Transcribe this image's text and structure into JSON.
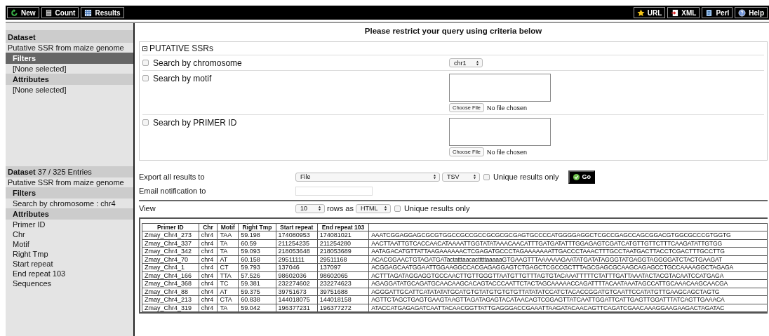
{
  "toolbar": {
    "left_buttons": [
      {
        "label": "New",
        "kind": "refresh"
      },
      {
        "label": "Count",
        "kind": "calculator"
      },
      {
        "label": "Results",
        "kind": "table"
      }
    ],
    "right_buttons": [
      {
        "label": "URL",
        "kind": "star"
      },
      {
        "label": "XML",
        "kind": "xml"
      },
      {
        "label": "Perl",
        "kind": "script"
      },
      {
        "label": "Help",
        "kind": "help"
      }
    ]
  },
  "sidebar": {
    "blocks": [
      {
        "heading": "Dataset",
        "name": "Putative SSR from maize genome",
        "filters_label": "Filters",
        "filters_active": true,
        "filters": [
          "[None selected]"
        ],
        "attributes_label": "Attributes",
        "attributes": [
          "[None selected]"
        ]
      },
      {
        "heading": "**Dataset** 37 / 325 Entries",
        "name": "Putative SSR from maize genome",
        "filters_label": "Filters",
        "filters_active": false,
        "filters": [
          "Search by chromosome : chr4"
        ],
        "attributes_label": "Attributes",
        "attributes": [
          "Primer ID",
          "Chr",
          "Motif",
          "Right Tmp",
          "Start repeat",
          "End repeat 103",
          "Sequences"
        ]
      }
    ]
  },
  "main": {
    "title": "Please restrict your query using criteria below",
    "filter_panel": {
      "title": "PUTATIVE SSRs",
      "expanded": true,
      "filters": [
        {
          "label": "Search by chromosome",
          "checked": false,
          "kind": "select",
          "value": "chr1"
        },
        {
          "label": "Search by motif",
          "checked": false,
          "kind": "upload",
          "button": "Choose File",
          "file_status": "No file chosen"
        },
        {
          "label": "Search by PRIMER ID",
          "checked": false,
          "kind": "upload",
          "button": "Choose File",
          "file_status": "No file chosen"
        }
      ]
    },
    "export": {
      "label": "Export  all results to",
      "destination": "File",
      "format": "TSV",
      "unique_label": "Unique results only",
      "unique_checked": false,
      "go": "Go"
    },
    "email": {
      "label": "Email notification to"
    },
    "view": {
      "label": "View",
      "rows": "10",
      "rows_as": "rows as",
      "format": "HTML",
      "unique_label": "Unique results only",
      "unique_checked": false
    },
    "table": {
      "columns": [
        "Primer ID",
        "Chr",
        "Motif",
        "Right Tmp",
        "Start repeat",
        "End repeat 103"
      ],
      "rows": [
        [
          "Zmay_Chr4_273",
          "chr4",
          "TAA",
          "59.198",
          "174080953",
          "174081021",
          "AAATCGGAGGAGCGCGTGGCCGCCGCCGCGCGCGAGTGCCCCATGGGGAGGCTCGCCGAGCCAGCGGACGTGGCGCCCGTGGTG"
        ],
        [
          "Zmay_Chr4_337",
          "chr4",
          "TA",
          "60.59",
          "211254235",
          "211254280",
          "AACTTAATTGTCACCAACATAAAATTGGTATATAAACAACATTTGATGATATTTGGAGAGTCGATCATGTTGTTCTTTCAAGATATTGTGG"
        ],
        [
          "Zmay_Chr4_342",
          "chr4",
          "TA",
          "59.093",
          "218053648",
          "218053689",
          "AATAGACATGTTATTAAGAAAAAACTCGAGATGCCCTAGAAAAAAATTGACCCTAAACTTTGCCTAATGACTTACCTCGACTTTGCCTTG"
        ],
        [
          "Zmay_Chr4_70",
          "chr4",
          "AT",
          "60.158",
          "29511111",
          "29511168",
          "ACACGGAACTGTAGATGATactatttaacactttttaaaaaGTGAAGTTTAAAAAAGAATATGATATAGGGTATGAGGTAGGGGATCTACTGAAGAT"
        ],
        [
          "Zmay_Chr4_1",
          "chr4",
          "CT",
          "59.793",
          "137046",
          "137097",
          "ACGGAGCAATGGAATTGGAAGGCCACGAGAGGAGTCTGAGCTCGCCGCTTTAGCGAGCGCAAGCAGAGCCTGCCAAAAGGCTAGAGA"
        ],
        [
          "Zmay_Chr4_166",
          "chr4",
          "TTA",
          "57.526",
          "98602036",
          "98602065",
          "ACTTTAGATAGGAGGTGCCAACTTGTTGGGTTAATGTTGTTTAGTGTACAAATTTTTCTATTTGATTAAATACTACGTACAATCCATGAGA"
        ],
        [
          "Zmay_Chr4_368",
          "chr4",
          "TC",
          "59.381",
          "232274602",
          "232274623",
          "AGAGGATATGCAGATGCAACAAGCACAGTACCCAATTCTACTAGCAAAAACCAGATTTTACAATAAATAGCCATTGCAAACAAGCAACGA"
        ],
        [
          "Zmay_Chr4_88",
          "chr4",
          "AT",
          "59.375",
          "39751673",
          "39751688",
          "AGGGATTGCATTCATATATATGCATGTGTATGTGTGTGTTATATATCCATCTACACCGGATGTCAATTCCATATGTTGAAGCAGCTAGTG"
        ],
        [
          "Zmay_Chr4_213",
          "chr4",
          "CTA",
          "60.838",
          "144018075",
          "144018158",
          "AGTTCTAGCTGAGTGAAGTAAGTTAGATAGAGTACATAACAGTCGGAGTTATCAATTGGATTCATTGAGTTGGATTTATCAGTTGAAACA"
        ],
        [
          "Zmay_Chr4_319",
          "chr4",
          "TA",
          "59.042",
          "196377231",
          "196377272",
          "ATACCATGAGAGATCAATTACAACGGTTATTGAGGGACCGAAATTAAGATACAACAGTTCAGATCGAACAAAGGAAGAAGACTAGATAC"
        ]
      ]
    }
  }
}
